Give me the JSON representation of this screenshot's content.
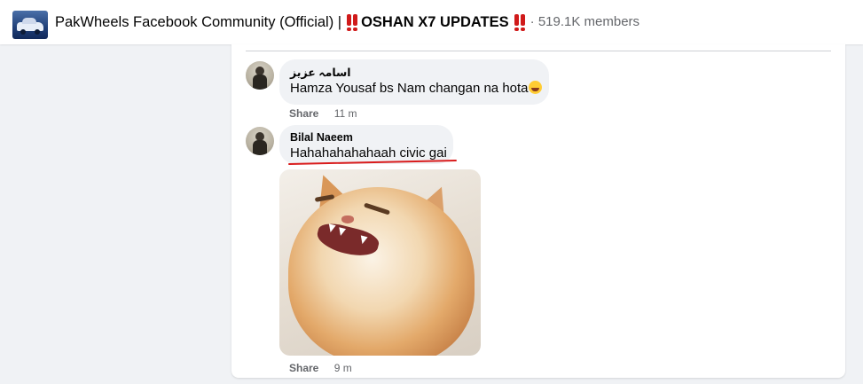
{
  "header": {
    "group_name": "PakWheels Facebook Community (Official) |",
    "post_title": "OSHAN X7 UPDATES",
    "members": "· 519.1K members"
  },
  "comments": [
    {
      "author": "اسامہ عزیز",
      "text": "Hamza Yousaf bs Nam changan na hota",
      "emoji": "rolling-on-floor-laughing-emoji",
      "share_label": "Share",
      "time": "11 m"
    },
    {
      "author": "Bilal Naeem",
      "text": "Hahahahahahaah civic gai",
      "image": "laughing-cat-meme",
      "share_label": "Share",
      "time": "9 m"
    }
  ],
  "colors": {
    "background": "#f0f2f5",
    "card": "#ffffff",
    "bubble": "#f0f2f5",
    "meta_text": "#65676b",
    "annotation_red": "#d91c1c"
  }
}
